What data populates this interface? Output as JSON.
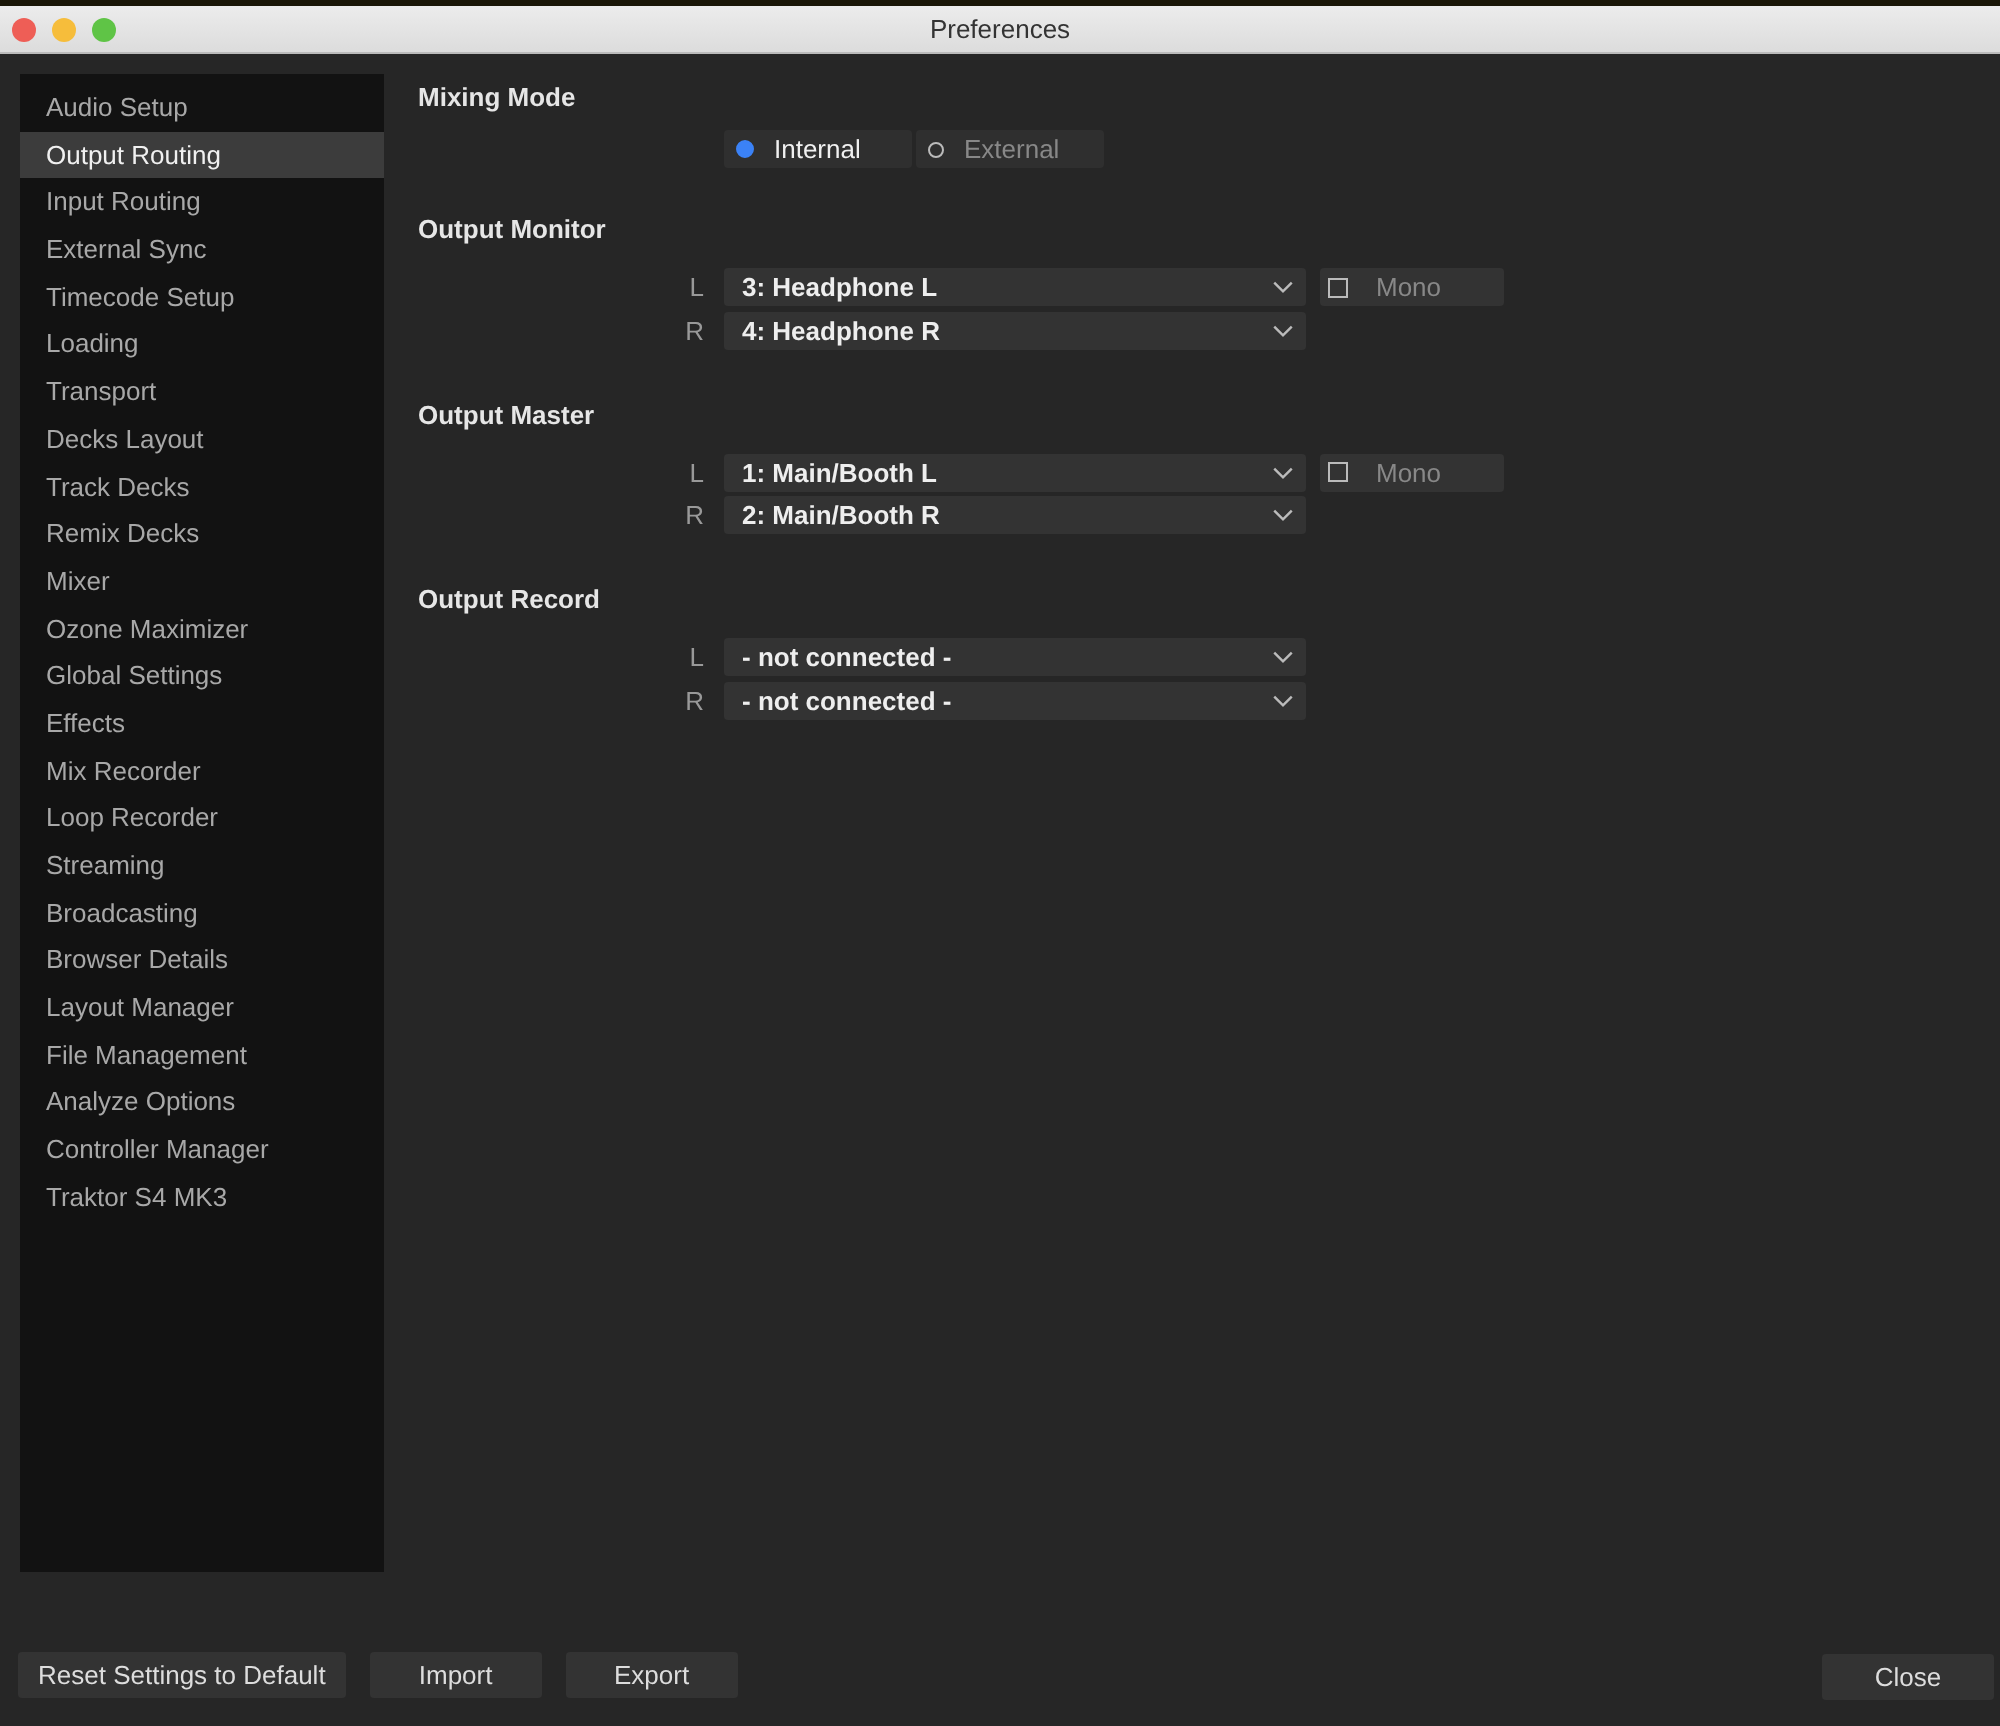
{
  "window": {
    "title": "Preferences"
  },
  "sidebar": {
    "items": [
      {
        "label": "Audio Setup",
        "selected": false
      },
      {
        "label": "Output Routing",
        "selected": true
      },
      {
        "label": "Input Routing",
        "selected": false
      },
      {
        "label": "External Sync",
        "selected": false
      },
      {
        "label": "Timecode Setup",
        "selected": false
      },
      {
        "label": "Loading",
        "selected": false
      },
      {
        "label": "Transport",
        "selected": false
      },
      {
        "label": "Decks Layout",
        "selected": false
      },
      {
        "label": "Track Decks",
        "selected": false
      },
      {
        "label": "Remix Decks",
        "selected": false
      },
      {
        "label": "Mixer",
        "selected": false
      },
      {
        "label": "Ozone Maximizer",
        "selected": false
      },
      {
        "label": "Global Settings",
        "selected": false
      },
      {
        "label": "Effects",
        "selected": false
      },
      {
        "label": "Mix Recorder",
        "selected": false
      },
      {
        "label": "Loop Recorder",
        "selected": false
      },
      {
        "label": "Streaming",
        "selected": false
      },
      {
        "label": "Broadcasting",
        "selected": false
      },
      {
        "label": "Browser Details",
        "selected": false
      },
      {
        "label": "Layout Manager",
        "selected": false
      },
      {
        "label": "File Management",
        "selected": false
      },
      {
        "label": "Analyze Options",
        "selected": false
      },
      {
        "label": "Controller Manager",
        "selected": false
      },
      {
        "label": "Traktor S4 MK3",
        "selected": false
      }
    ]
  },
  "mixing_mode": {
    "heading": "Mixing Mode",
    "options": [
      {
        "label": "Internal",
        "selected": true
      },
      {
        "label": "External",
        "selected": false
      }
    ]
  },
  "sections": [
    {
      "heading": "Output Monitor",
      "channels": [
        {
          "side": "L",
          "value": "3: Headphone L",
          "mono": {
            "label": "Mono",
            "checked": false
          }
        },
        {
          "side": "R",
          "value": "4: Headphone R"
        }
      ]
    },
    {
      "heading": "Output Master",
      "channels": [
        {
          "side": "L",
          "value": "1: Main/Booth L",
          "mono": {
            "label": "Mono",
            "checked": false
          }
        },
        {
          "side": "R",
          "value": "2: Main/Booth R"
        }
      ]
    },
    {
      "heading": "Output Record",
      "channels": [
        {
          "side": "L",
          "value": "- not connected -"
        },
        {
          "side": "R",
          "value": "- not connected -"
        }
      ]
    }
  ],
  "footer": {
    "left_buttons": [
      "Reset Settings to Default",
      "Import",
      "Export"
    ],
    "close_button": "Close"
  }
}
